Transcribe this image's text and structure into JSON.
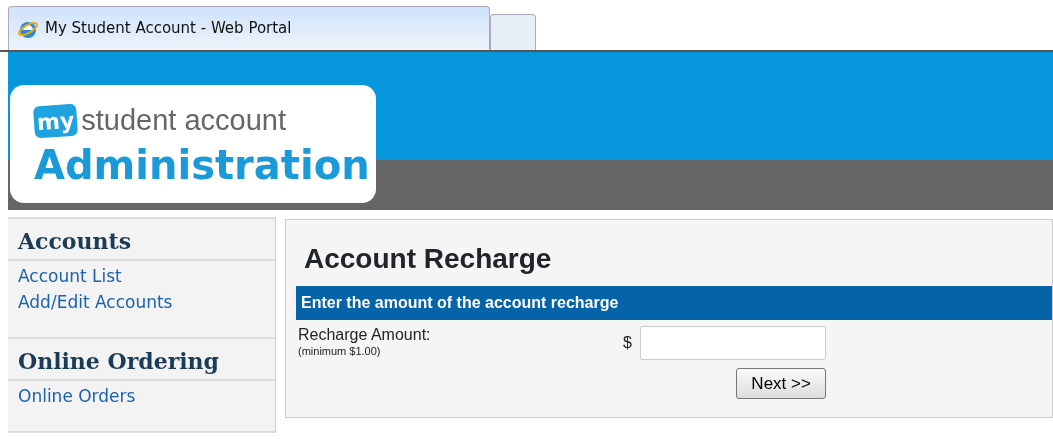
{
  "browser_tab": {
    "title": "My Student Account - Web Portal"
  },
  "logo": {
    "badge": "my",
    "name": "student account",
    "subtitle": "Administration"
  },
  "sidebar": [
    {
      "heading": "Accounts",
      "links": [
        "Account List",
        "Add/Edit Accounts"
      ]
    },
    {
      "heading": "Online Ordering",
      "links": [
        "Online Orders"
      ]
    }
  ],
  "main": {
    "title": "Account Recharge",
    "section_header": "Enter the amount of the account recharge",
    "field": {
      "label": "Recharge Amount:",
      "hint": "(minimum $1.00)",
      "prefix": "$"
    },
    "button": "Next >>"
  }
}
